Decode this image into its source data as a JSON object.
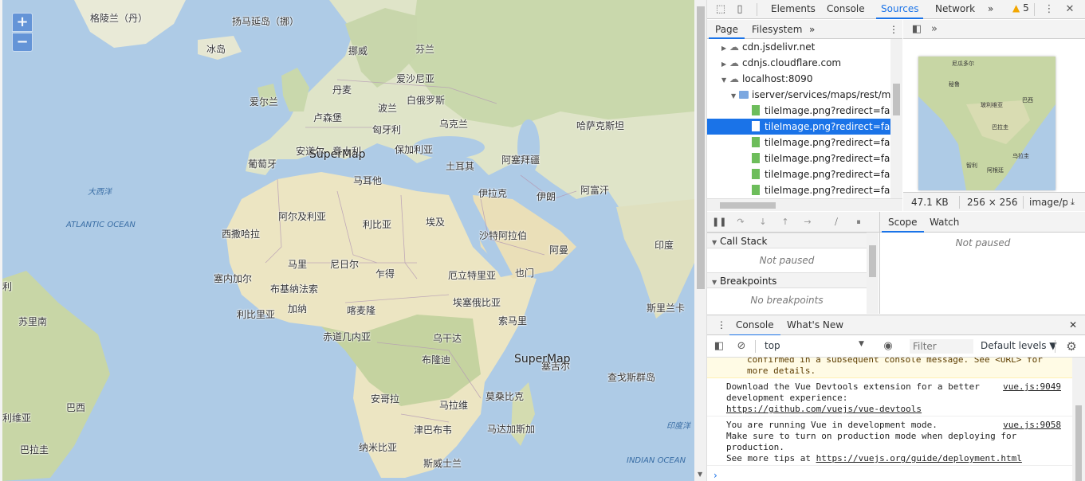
{
  "map": {
    "zoom_in": "+",
    "zoom_out": "−",
    "watermark": "SuperMap",
    "labels": {
      "greenland": "格陵兰（丹）",
      "jan_mayen": "扬马延岛（挪）",
      "iceland": "冰岛",
      "norway": "挪威",
      "finland": "芬兰",
      "estonia": "爱沙尼亚",
      "denmark": "丹麦",
      "ireland": "爱尔兰",
      "poland": "波兰",
      "belarus": "白俄罗斯",
      "luxembourg": "卢森堡",
      "ukraine": "乌克兰",
      "kazakhstan": "哈萨克斯坦",
      "hungary": "匈牙利",
      "andorra": "安道尔",
      "italy": "意大利",
      "bulgaria": "保加利亚",
      "portugal": "葡萄牙",
      "turkey": "土耳其",
      "azerbaijan": "阿塞拜疆",
      "malta": "马耳他",
      "iraq": "伊拉克",
      "iran": "伊朗",
      "afghanistan": "阿富汗",
      "algeria": "阿尔及利亚",
      "libya": "利比亚",
      "egypt": "埃及",
      "western_sahara": "西撒哈拉",
      "saudi": "沙特阿拉伯",
      "oman": "阿曼",
      "india": "印度",
      "mali": "马里",
      "niger": "尼日尔",
      "chad": "乍得",
      "senegal": "塞内加尔",
      "eritrea": "厄立特里亚",
      "yemen": "也门",
      "burkina": "布基纳法索",
      "ghana": "加纳",
      "ethiopia": "埃塞俄比亚",
      "srilanka": "斯里兰卡",
      "liberia": "利比里亚",
      "nigeria": "喀麦隆",
      "somalia": "索马里",
      "suriname": "苏里南",
      "eq_guinea": "赤道几内亚",
      "uganda": "乌干达",
      "burundi": "布隆迪",
      "seychelles": "塞舌尔",
      "chagos": "查戈斯群岛",
      "brazil": "巴西",
      "angola": "安哥拉",
      "zambia": "马拉维",
      "mozambique": "莫桑比克",
      "bolivia": "利维亚",
      "zimbabwe": "津巴布韦",
      "madagascar": "马达加斯加",
      "paraguay": "巴拉圭",
      "namibia": "纳米比亚",
      "eswatini": "斯威士兰",
      "peru_edge": "利",
      "atlantic_cn": "大西洋",
      "atlantic_en": "ATLANTIC OCEAN",
      "indian_cn": "印度洋",
      "indian_en": "INDIAN OCEAN"
    }
  },
  "devtools": {
    "tabs": [
      "Elements",
      "Console",
      "Sources",
      "Network"
    ],
    "more": "»",
    "warnings": "5",
    "nav_tabs": [
      "Page",
      "Filesystem"
    ],
    "tree": [
      {
        "label": "cdn.jsdelivr.net"
      },
      {
        "label": "cdnjs.cloudflare.com"
      },
      {
        "label": "localhost:8090"
      },
      {
        "label": "iserver/services/maps/rest/map"
      },
      {
        "label": "tileImage.png?redirect=false&"
      },
      {
        "label": "tileImage.png?redirect=false&"
      },
      {
        "label": "tileImage.png?redirect=false&"
      },
      {
        "label": "tileImage.png?redirect=false&"
      },
      {
        "label": "tileImage.png?redirect=false&"
      },
      {
        "label": "tileImage.png?redirect=false&"
      }
    ],
    "preview": {
      "size": "47.1 KB",
      "dims": "256 × 256",
      "mime": "image/png",
      "labels": [
        "尼瓜多尔",
        "秘鲁",
        "玻利维亚",
        "巴西",
        "巴拉圭",
        "智利",
        "阿根廷",
        "乌拉圭"
      ]
    },
    "scope_tabs": [
      "Scope",
      "Watch"
    ],
    "not_paused": "Not paused",
    "call_stack": "Call Stack",
    "call_stack_body": "Not paused",
    "breakpoints": "Breakpoints",
    "breakpoints_body": "No breakpoints",
    "drawer_tabs": [
      "Console",
      "What's New"
    ],
    "context": "top",
    "filter_placeholder": "Filter",
    "levels": "Default levels ▼",
    "messages": {
      "warn_line1": "confirmed in a subsequent console message. See <URL> for",
      "warn_line2": "more details.",
      "m1_line1": "Download the Vue Devtools extension for a better",
      "m1_line2": "development experience:",
      "m1_link": "https://github.com/vuejs/vue-devtools",
      "m1_src": "vue.js:9049",
      "m2_line1": "You are running Vue in development mode.",
      "m2_line2": "Make sure to turn on production mode when deploying for",
      "m2_line3": "production.",
      "m2_line4_pre": "See more tips at ",
      "m2_link": "https://vuejs.org/guide/deployment.html",
      "m2_src": "vue.js:9058"
    },
    "prompt": "›"
  }
}
